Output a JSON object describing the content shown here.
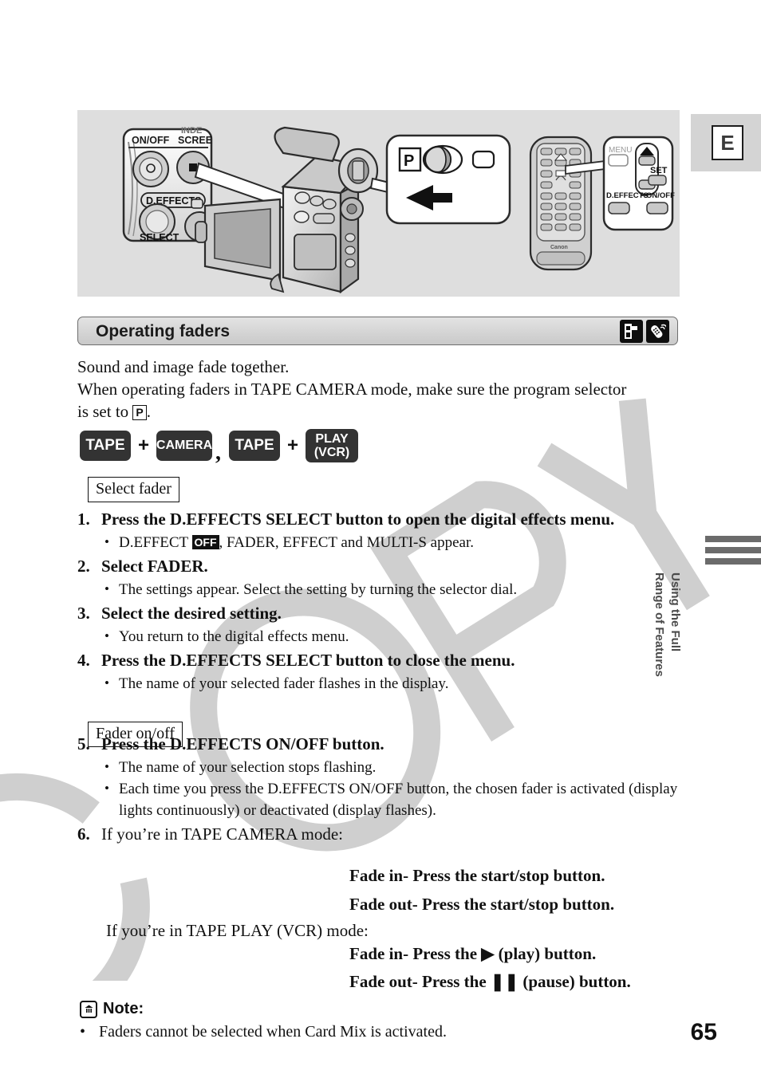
{
  "margin": {
    "language_tab": "E",
    "side_label_line1": "Using the Full",
    "side_label_line2": "Range of Features"
  },
  "illustration": {
    "camera_panel": {
      "label_onoff": "ON/OFF",
      "label_screen": "SCREE",
      "label_index": "INDE",
      "label_deffects": "D.EFFECTS",
      "label_select": "SELECT"
    },
    "program_callout": {
      "mode_p": "P",
      "arrow": "left-arrow"
    },
    "remote_panel": {
      "label_menu": "MENU",
      "label_set": "SET",
      "label_deffects": "D.EFFECTS",
      "label_onoff": "ON/OFF",
      "brand": "Canon"
    }
  },
  "section": {
    "title": "Operating faders",
    "badges": [
      "camcorder-icon",
      "remote-icon"
    ]
  },
  "intro": {
    "line1": "Sound and image fade together.",
    "line2_a": "When operating faders in TAPE CAMERA mode, make sure the program selector",
    "line2_b": "is set to ",
    "program_glyph": "P",
    "line2_c": "."
  },
  "mode_row": {
    "tape1": "TAPE",
    "plus1": "+",
    "camera": "CAMERA",
    "comma": ",",
    "tape2": "TAPE",
    "plus2": "+",
    "play_line1": "PLAY",
    "play_line2": "(VCR)"
  },
  "labels": {
    "select_fader": "Select fader",
    "fader_onoff": "Fader on/off"
  },
  "steps": [
    {
      "num": "1.",
      "title": "Press the D.EFFECTS SELECT button to open the digital effects menu.",
      "bullet_pre": "D.EFFECT ",
      "bullet_glyph": "OFF",
      "bullet_post": ", FADER, EFFECT and MULTI-S appear."
    },
    {
      "num": "2.",
      "title": "Select FADER.",
      "bullet": "The settings appear. Select the setting by turning the selector dial."
    },
    {
      "num": "3.",
      "title": "Select the desired setting.",
      "bullet": "You return to the digital effects menu."
    },
    {
      "num": "4.",
      "title": "Press the D.EFFECTS SELECT button to close the menu.",
      "bullet": "The name of your selected fader flashes in the display."
    },
    {
      "num": "5.",
      "title": "Press the D.EFFECTS ON/OFF button.",
      "bullet1": "The name of your selection stops flashing.",
      "bullet2": "Each time you press the D.EFFECTS ON/OFF button, the chosen fader is activated (display lights continuously) or deactivated (display flashes)."
    },
    {
      "num": "6.",
      "title": "If you’re in TAPE CAMERA mode:"
    }
  ],
  "fade_instructions": {
    "camera_fade_in": "Fade in- Press the start/stop button.",
    "camera_fade_out": "Fade out- Press the start/stop button.",
    "vcr_intro": "If you’re in TAPE PLAY (VCR) mode:",
    "vcr_fade_in_pre": "Fade in- Press the ",
    "vcr_play_glyph": "▶",
    "vcr_fade_in_post": " (play) button.",
    "vcr_fade_out_pre": "Fade out- Press the ",
    "vcr_pause_glyph": "❚❚",
    "vcr_fade_out_post": " (pause) button."
  },
  "note": {
    "icon": "note-icon",
    "title": "Note:",
    "text": "Faders cannot be selected when Card Mix is activated."
  },
  "page_number": "65",
  "watermark": "COPY"
}
